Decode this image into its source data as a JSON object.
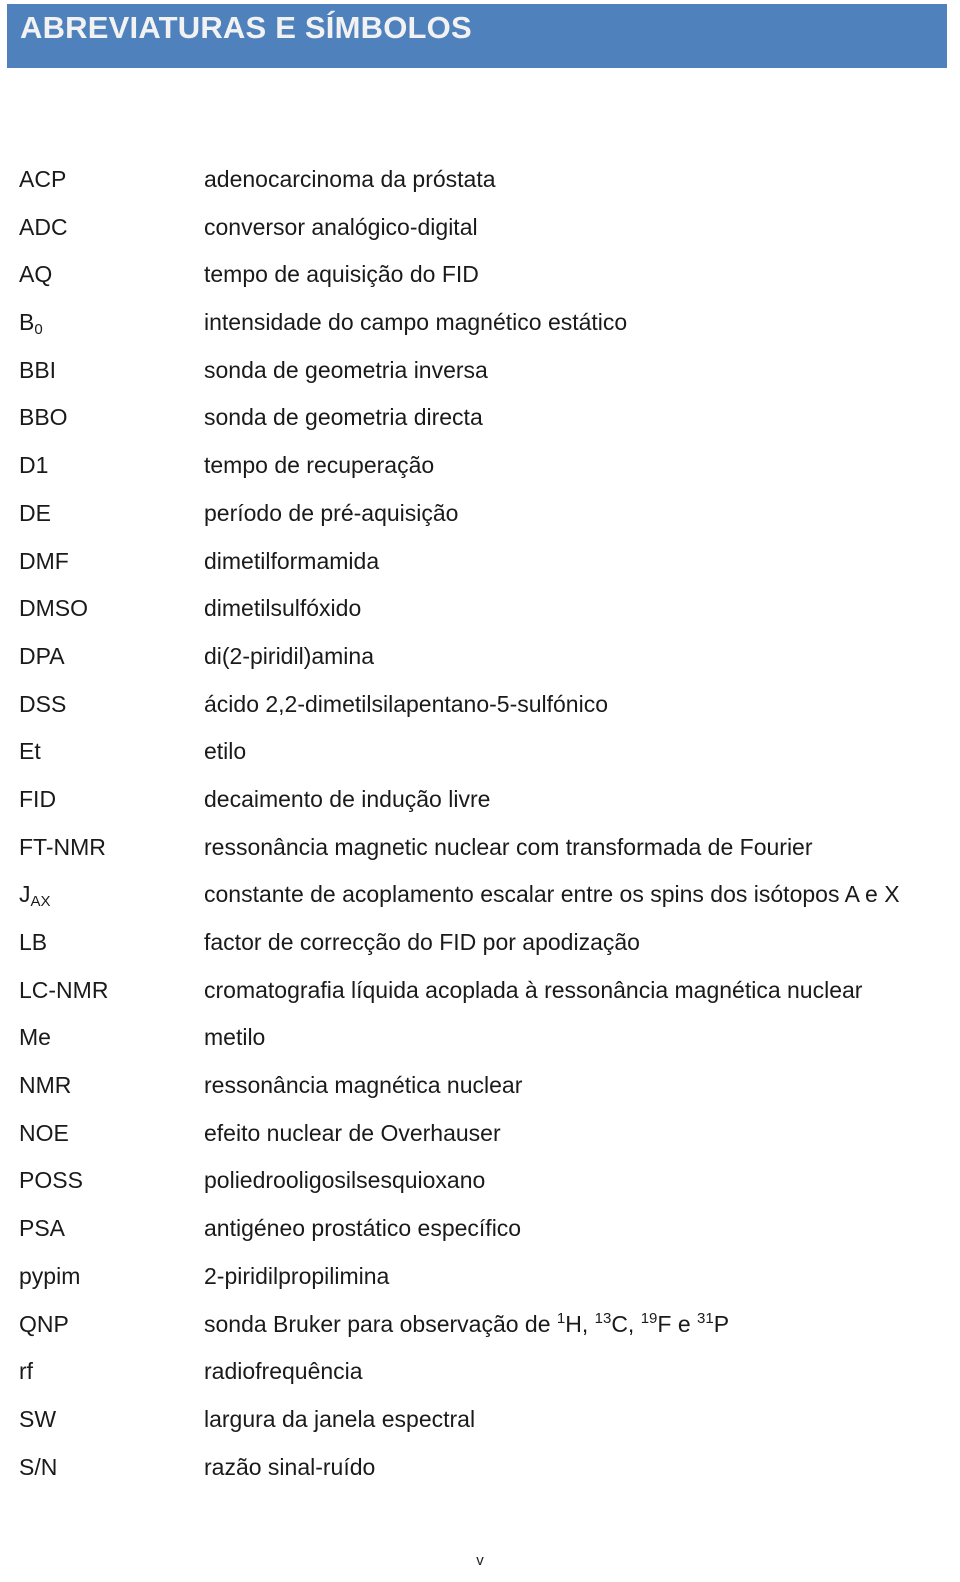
{
  "header": {
    "title": "ABREVIATURAS E SÍMBOLOS",
    "bar_color": "#4f81bd",
    "text_color": "#f2f2f2"
  },
  "entries": [
    {
      "abbr": "ACP",
      "def": "adenocarcinoma da próstata"
    },
    {
      "abbr": "ADC",
      "def": "conversor analógico-digital"
    },
    {
      "abbr": "AQ",
      "def": "tempo de aquisição do FID"
    },
    {
      "abbr_main": "B",
      "abbr_sub": "0",
      "def": "intensidade do campo magnético estático"
    },
    {
      "abbr": "BBI",
      "def": "sonda de geometria inversa"
    },
    {
      "abbr": "BBO",
      "def": "sonda de geometria directa"
    },
    {
      "abbr": "D1",
      "def": "tempo de recuperação"
    },
    {
      "abbr": "DE",
      "def": "período de pré-aquisição"
    },
    {
      "abbr": "DMF",
      "def": "dimetilformamida"
    },
    {
      "abbr": "DMSO",
      "def": "dimetilsulfóxido"
    },
    {
      "abbr": "DPA",
      "def": "di(2-piridil)amina"
    },
    {
      "abbr": "DSS",
      "def": "ácido 2,2-dimetilsilapentano-5-sulfónico"
    },
    {
      "abbr": "Et",
      "def": "etilo"
    },
    {
      "abbr": "FID",
      "def": "decaimento de indução livre"
    },
    {
      "abbr": "FT-NMR",
      "def": "ressonância magnetic nuclear com transformada de Fourier"
    },
    {
      "abbr_main": "J",
      "abbr_sub": "AX",
      "def": "constante de acoplamento escalar entre os spins dos isótopos A e X"
    },
    {
      "abbr": "LB",
      "def": "factor de correcção do FID por apodização"
    },
    {
      "abbr": "LC-NMR",
      "def": "cromatografia líquida acoplada à ressonância magnética nuclear"
    },
    {
      "abbr": "Me",
      "def": "metilo"
    },
    {
      "abbr": "NMR",
      "def": "ressonância magnética nuclear"
    },
    {
      "abbr": "NOE",
      "def": "efeito nuclear de Overhauser"
    },
    {
      "abbr": "POSS",
      "def": "poliedrooligosilsesquioxano"
    },
    {
      "abbr": "PSA",
      "def": "antigéneo prostático específico"
    },
    {
      "abbr": "pypim",
      "def": "2-piridilpropilimina"
    },
    {
      "abbr": "QNP",
      "def_parts": {
        "prefix": "sonda Bruker para observação de ",
        "iso1_sup": "1",
        "iso1": "H, ",
        "iso2_sup": "13",
        "iso2": "C, ",
        "iso3_sup": "19",
        "iso3": "F e ",
        "iso4_sup": "31",
        "iso4": "P"
      }
    },
    {
      "abbr": "rf",
      "def": "radiofrequência"
    },
    {
      "abbr": "SW",
      "def": "largura da janela espectral"
    },
    {
      "abbr": "S/N",
      "def": "razão sinal-ruído"
    }
  ],
  "footer": {
    "page_number": "v"
  }
}
